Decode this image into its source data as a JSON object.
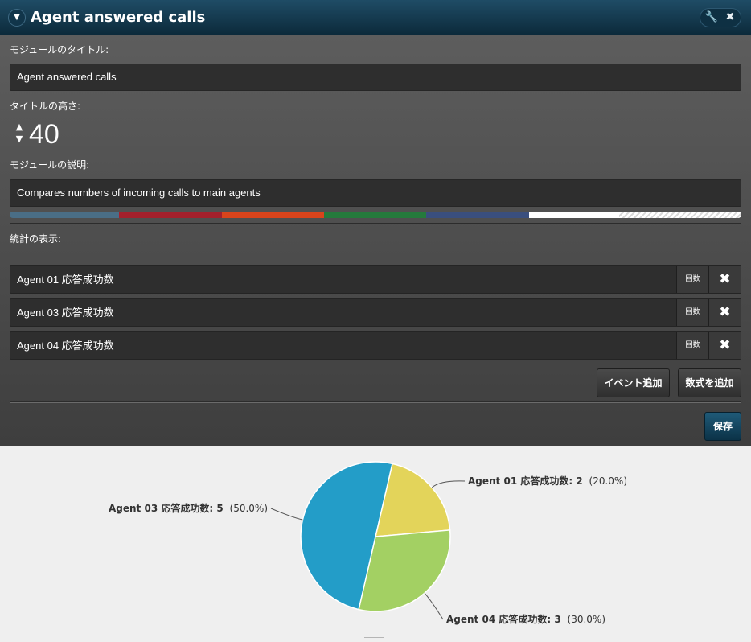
{
  "window": {
    "title": "Agent answered calls",
    "collapse_icon": "▼",
    "wrench_icon": "🔧",
    "close_icon": "✖"
  },
  "form": {
    "module_title_label": "モジュールのタイトル:",
    "module_title_value": "Agent answered calls",
    "title_height_label": "タイトルの高さ:",
    "title_height_value": "40",
    "stepper_up": "▲",
    "stepper_down": "▼",
    "description_label": "モジュールの説明:",
    "description_value": "Compares numbers of incoming calls to main agents",
    "palette": [
      "#4a6e86",
      "#a3202c",
      "#d9441c",
      "#257a3c",
      "#3a4f7e",
      "#ffffff"
    ],
    "stats_label": "統計の表示:",
    "stats": [
      {
        "name": "Agent 01 応答成功数",
        "type": "回数",
        "remove": "✖"
      },
      {
        "name": "Agent 03 応答成功数",
        "type": "回数",
        "remove": "✖"
      },
      {
        "name": "Agent 04 応答成功数",
        "type": "回数",
        "remove": "✖"
      }
    ],
    "add_event_button": "イベント追加",
    "add_formula_button": "数式を追加",
    "save_button": "保存"
  },
  "chart_data": {
    "type": "pie",
    "slices": [
      {
        "name": "Agent 01 応答成功数",
        "value": 2,
        "label": "Agent 01 応答成功数: 2",
        "percent": "(20.0%)",
        "color": "#e3d45a"
      },
      {
        "name": "Agent 04 応答成功数",
        "value": 3,
        "label": "Agent 04 応答成功数: 3",
        "percent": "(30.0%)",
        "color": "#a3d063"
      },
      {
        "name": "Agent 03 応答成功数",
        "value": 5,
        "label": "Agent 03 応答成功数: 5",
        "percent": "(50.0%)",
        "color": "#239dc8"
      }
    ],
    "start_angle_deg": 13,
    "direction": "clockwise"
  }
}
